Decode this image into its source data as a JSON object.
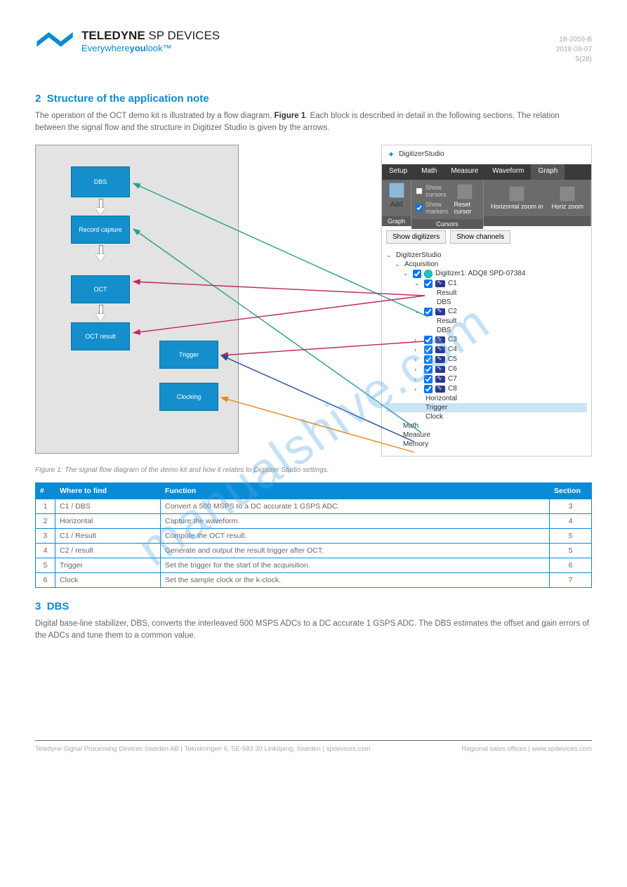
{
  "logo": {
    "brand_bold": "TELEDYNE",
    "brand_light": " SP DEVICES",
    "tagline_pre": "Everywhere",
    "tagline_bold": "you",
    "tagline_post": "look™"
  },
  "doc_meta": {
    "line1": "18-2059-B",
    "line2": "2018-09-07",
    "line3": "5(28)"
  },
  "watermark": "manualshive.com",
  "section1": {
    "number": "2",
    "title": "Structure of the application note",
    "p1_pre": "The operation of the OCT demo kit is illustrated by a flow diagram, ",
    "p1_bold": "Figure 1",
    "p1_post": ". Each block is described in detail in the following sections. The relation between the signal flow and the structure in Digitizer Studio is given by the arrows."
  },
  "flow": {
    "b1": "DBS",
    "b2": "Record capture",
    "b3": "OCT",
    "b4": "OCT result",
    "b5": "Trigger",
    "b6": "Clocking"
  },
  "screenshot": {
    "title": "DigitizerStudio",
    "tabs": [
      "Setup",
      "Math",
      "Measure",
      "Waveform",
      "Graph"
    ],
    "ribbon": {
      "add": "Add",
      "show_cursors": "Show cursors",
      "show_markers": "Show markers",
      "reset_cursor": "Reset cursor",
      "hz_in": "Horizontal zoom in",
      "hz_out": "Horiz zoom",
      "group_graph": "Graph",
      "group_cursors": "Cursors"
    },
    "toolbar": {
      "show_digitizers": "Show digitizers",
      "show_channels": "Show channels"
    },
    "tree": {
      "root": "DigitizerStudio",
      "acq": "Acquisition",
      "dig": "Digitizer1: ADQ8 SPD-07384",
      "c1": "C1",
      "c1_result": "Result",
      "c1_dbs": "DBS",
      "c2": "C2",
      "c2_result": "Result",
      "c2_dbs": "DBS",
      "c3": "C3",
      "c4": "C4",
      "c5": "C5",
      "c6": "C6",
      "c7": "C7",
      "c8": "C8",
      "horizontal": "Horizontal",
      "trigger": "Trigger",
      "clock": "Clock",
      "math": "Math",
      "measure": "Measure",
      "memory": "Memory"
    }
  },
  "fig_caption": "Figure 1: The signal flow diagram of the demo kit and how it relates to Digitizer Studio settings.",
  "table": {
    "headers": [
      "#",
      "Where to find",
      "Function",
      "Section"
    ],
    "rows": [
      [
        "1",
        "C1 / DBS",
        "Convert a 500 MSPS to a DC accurate 1 GSPS ADC.",
        "3"
      ],
      [
        "2",
        "Horizontal",
        "Capture the waveform.",
        "4"
      ],
      [
        "3",
        "C1 / Result",
        "Compute the OCT result.",
        "5"
      ],
      [
        "4",
        "C2 / result",
        "Generate and output the result trigger after OCT.",
        "5"
      ],
      [
        "5",
        "Trigger",
        "Set the trigger for the start of the acquisition.",
        "6"
      ],
      [
        "6",
        "Clock",
        "Set the sample clock or the k-clock.",
        "7"
      ]
    ]
  },
  "section2": {
    "number": "3",
    "title": "DBS",
    "p1": "Digital base-line stabilizer, DBS, converts the interleaved 500 MSPS ADCs to a DC accurate 1 GSPS ADC. The DBS estimates the offset and gain errors of the ADCs and tune them to a common value."
  },
  "footer": {
    "left": "Teledyne Signal Processing Devices Sweden AB | Teknikringen 6, SE-583 30 Linköping, Sweden |  spdevices.com",
    "right": "Regional sales offices | www.spdevices.com"
  }
}
